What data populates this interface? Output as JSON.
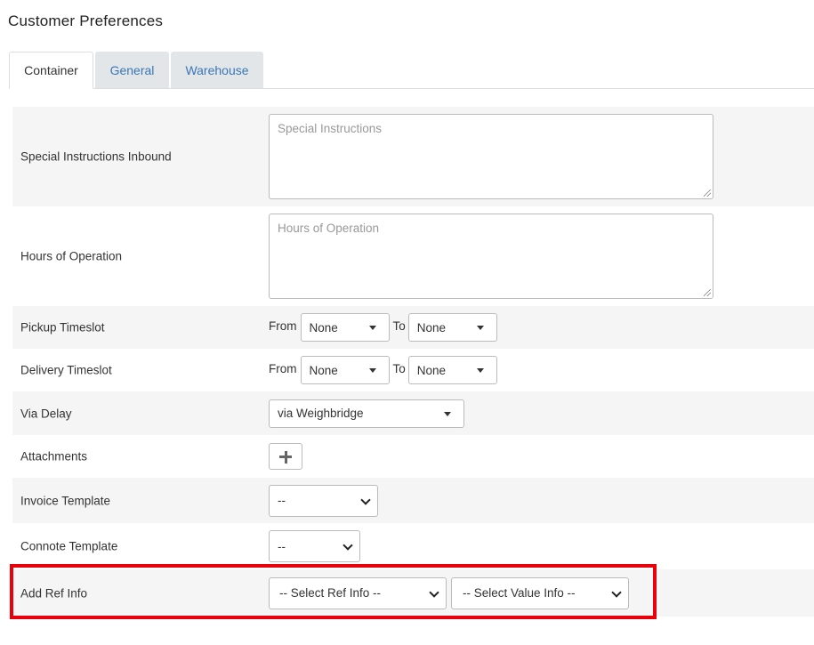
{
  "page": {
    "title": "Customer Preferences"
  },
  "tabs": [
    {
      "label": "Container",
      "active": true
    },
    {
      "label": "General",
      "active": false
    },
    {
      "label": "Warehouse",
      "active": false
    }
  ],
  "form": {
    "special_instructions_inbound": {
      "label": "Special Instructions Inbound",
      "placeholder": "Special Instructions"
    },
    "hours_of_operation": {
      "label": "Hours of Operation",
      "placeholder": "Hours of Operation"
    },
    "pickup_timeslot": {
      "label": "Pickup Timeslot",
      "from_label": "From",
      "from_value": "None",
      "to_label": "To",
      "to_value": "None"
    },
    "delivery_timeslot": {
      "label": "Delivery Timeslot",
      "from_label": "From",
      "from_value": "None",
      "to_label": "To",
      "to_value": "None"
    },
    "via_delay": {
      "label": "Via Delay",
      "value": "via Weighbridge"
    },
    "attachments": {
      "label": "Attachments",
      "icon": "plus-icon"
    },
    "invoice_template": {
      "label": "Invoice Template",
      "value": "--"
    },
    "connote_template": {
      "label": "Connote Template",
      "value": "--"
    },
    "add_ref_info": {
      "label": "Add Ref Info",
      "ref_value": "-- Select Ref Info --",
      "value_value": "-- Select Value Info --"
    }
  },
  "colors": {
    "highlight": "#e8000b",
    "tab_link": "#3a77b5",
    "row_alt": "#f5f5f5"
  }
}
